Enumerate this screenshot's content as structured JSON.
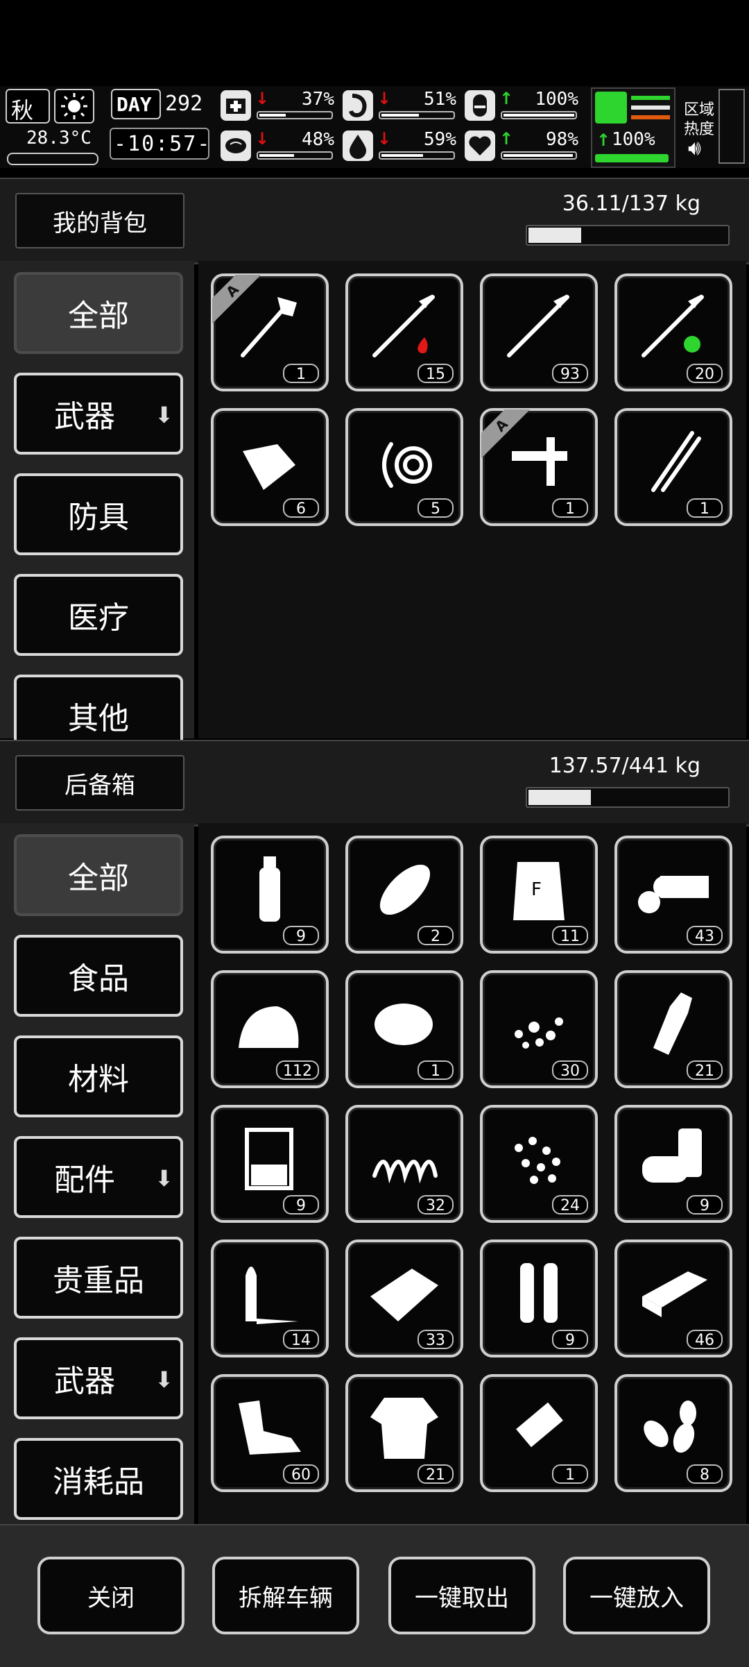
{
  "status": {
    "season": "秋",
    "temperature": "28.3°C",
    "day_label": "DAY",
    "day_number": "292",
    "time": "-10:57-",
    "stats": [
      {
        "id": "health",
        "arrow": "down",
        "value": "37%",
        "fill": 0.37
      },
      {
        "id": "hunger",
        "arrow": "down",
        "value": "51%",
        "fill": 0.51
      },
      {
        "id": "sleep",
        "arrow": "up",
        "value": "100%",
        "fill": 1.0
      },
      {
        "id": "mood",
        "arrow": "down",
        "value": "48%",
        "fill": 0.48
      },
      {
        "id": "thirst",
        "arrow": "down",
        "value": "59%",
        "fill": 0.59
      },
      {
        "id": "heart",
        "arrow": "up",
        "value": "98%",
        "fill": 0.98
      }
    ],
    "stamina": {
      "arrow": "up",
      "value": "100%",
      "fill": 1.0
    },
    "region_label_1": "区域",
    "region_label_2": "热度",
    "colors": {
      "down": "#e01010",
      "up": "#2fd52f"
    }
  },
  "backpack": {
    "title": "我的背包",
    "weight": "36.11/137 kg",
    "weight_fill": 0.2636,
    "categories": [
      {
        "label": "全部",
        "active": true,
        "has_arrow": false
      },
      {
        "label": "武器",
        "active": false,
        "has_arrow": true
      },
      {
        "label": "防具",
        "active": false,
        "has_arrow": false
      },
      {
        "label": "医疗",
        "active": false,
        "has_arrow": false
      },
      {
        "label": "其他",
        "active": false,
        "has_arrow": false
      }
    ],
    "items": [
      {
        "icon": "shovel-icon",
        "count": "1",
        "badge": "A"
      },
      {
        "icon": "fire-arrow-icon",
        "count": "15",
        "badge": ""
      },
      {
        "icon": "arrow-icon",
        "count": "93",
        "badge": ""
      },
      {
        "icon": "poison-arrow-icon",
        "count": "20",
        "badge": ""
      },
      {
        "icon": "bandage-roll-icon",
        "count": "6",
        "badge": ""
      },
      {
        "icon": "rope-icon",
        "count": "5",
        "badge": ""
      },
      {
        "icon": "caliper-knife-icon",
        "count": "1",
        "badge": "A"
      },
      {
        "icon": "lockpick-icon",
        "count": "1",
        "badge": ""
      }
    ]
  },
  "trunk": {
    "title": "后备箱",
    "weight": "137.57/441 kg",
    "weight_fill": 0.312,
    "categories": [
      {
        "label": "全部",
        "active": true,
        "has_arrow": false
      },
      {
        "label": "食品",
        "active": false,
        "has_arrow": false
      },
      {
        "label": "材料",
        "active": false,
        "has_arrow": false
      },
      {
        "label": "配件",
        "active": false,
        "has_arrow": true
      },
      {
        "label": "贵重品",
        "active": false,
        "has_arrow": false
      },
      {
        "label": "武器",
        "active": false,
        "has_arrow": true
      },
      {
        "label": "消耗品",
        "active": false,
        "has_arrow": false
      }
    ],
    "items": [
      {
        "icon": "water-bottle-icon",
        "count": "9"
      },
      {
        "icon": "bread-icon",
        "count": "2"
      },
      {
        "icon": "flour-bag-icon",
        "count": "11"
      },
      {
        "icon": "logs-icon",
        "count": "43"
      },
      {
        "icon": "cloth-pile-icon",
        "count": "112"
      },
      {
        "icon": "fiber-icon",
        "count": "1"
      },
      {
        "icon": "gravel-icon",
        "count": "30"
      },
      {
        "icon": "glass-bottle-icon",
        "count": "21"
      },
      {
        "icon": "beaker-icon",
        "count": "9"
      },
      {
        "icon": "spring-icon",
        "count": "32"
      },
      {
        "icon": "pellets-icon",
        "count": "24"
      },
      {
        "icon": "cans-icon",
        "count": "9"
      },
      {
        "icon": "bullet-icon",
        "count": "14"
      },
      {
        "icon": "fabric-icon",
        "count": "33"
      },
      {
        "icon": "shells-icon",
        "count": "9"
      },
      {
        "icon": "brick-icon",
        "count": "46"
      },
      {
        "icon": "scrap-metal-icon",
        "count": "60"
      },
      {
        "icon": "ragged-shirt-icon",
        "count": "21"
      },
      {
        "icon": "battery-pack-icon",
        "count": "1"
      },
      {
        "icon": "bullet-tips-icon",
        "count": "8"
      }
    ]
  },
  "actions": [
    {
      "id": "close",
      "label": "关闭"
    },
    {
      "id": "dismantle",
      "label": "拆解车辆"
    },
    {
      "id": "take_all",
      "label": "一键取出"
    },
    {
      "id": "put_all",
      "label": "一键放入"
    }
  ]
}
